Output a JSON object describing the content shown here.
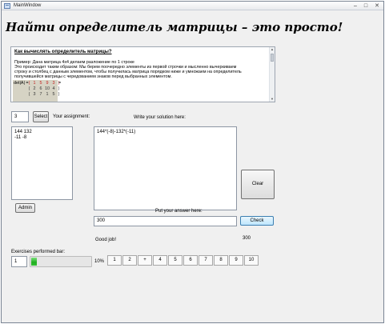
{
  "window": {
    "title": "MainWindow",
    "controls": {
      "minimize": "–",
      "maximize": "□",
      "close": "✕"
    }
  },
  "heading": "Найти определитель матрицы – это просто!",
  "instructions": {
    "title": "Как вычислять определитель матрицы?",
    "example": "Пример: Дана матрица 4х4 делаем разложение по 1 строке",
    "paragraph_lines": [
      "Это происходит таким образом: Мы берем поочередно элементы из первой строчки и мысленно вычеркиваем",
      "строку и столбец с данным элементом, чтобы получилась матрица порядком ниже и умножаем на определитель",
      "получившейся матрицы с чередованием знаков перед выбранных элементом."
    ],
    "det_label": "det|A| =",
    "matrix_rows": [
      [
        "(",
        "1",
        "5",
        "9",
        "3",
        ")"
      ],
      [
        "(",
        "2",
        "6",
        "10",
        "4",
        ")"
      ],
      [
        "(",
        "3",
        "7",
        "1",
        "5",
        ")"
      ]
    ],
    "after_matrix": "="
  },
  "exercise": {
    "number": "3",
    "select_label": "Select",
    "assignment_label": "Your assignment:",
    "assignment_text": "144 132\n-11 -8",
    "solution_label": "Write your solution here:",
    "solution_text": "144*(-8)-132*(-11)"
  },
  "buttons": {
    "clear": "Clear",
    "admin": "Admin",
    "check": "Check"
  },
  "answer": {
    "label": "Put your answer here:",
    "value": "300",
    "check_result": "300",
    "feedback": "Good job!"
  },
  "progress": {
    "label": "Exercises performed bar:",
    "counter": "1",
    "percent_text": "10%",
    "fraction": 0.1,
    "fill_color": "#22b022"
  },
  "exercise_tabs": [
    "1",
    "2",
    "+",
    "4",
    "5",
    "6",
    "7",
    "8",
    "9",
    "10"
  ]
}
